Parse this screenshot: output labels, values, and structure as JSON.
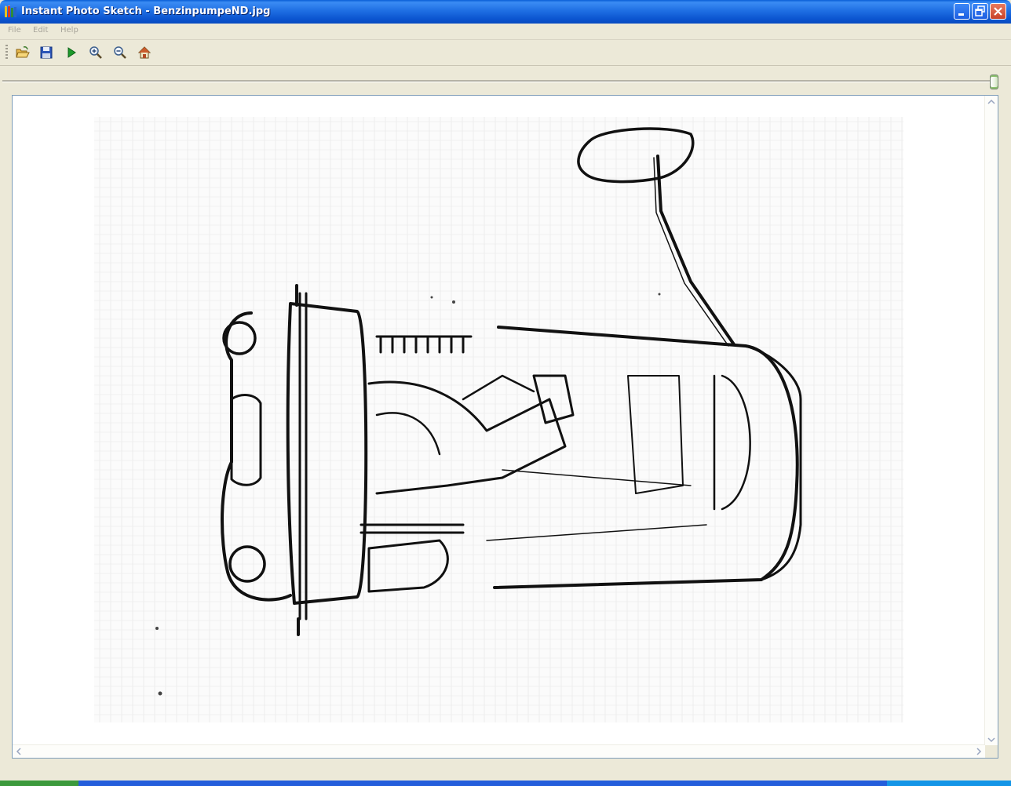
{
  "window": {
    "title": "Instant Photo Sketch - BenzinpumpeND.jpg",
    "controls": [
      "minimize",
      "maximize",
      "close"
    ]
  },
  "menu": {
    "items": [
      {
        "label": "File"
      },
      {
        "label": "Edit"
      },
      {
        "label": "Help"
      }
    ]
  },
  "toolbar": {
    "buttons": [
      {
        "name": "open",
        "icon": "folder-open-icon"
      },
      {
        "name": "save",
        "icon": "floppy-disk-icon"
      },
      {
        "name": "run",
        "icon": "play-icon"
      },
      {
        "name": "zoom-in",
        "icon": "zoom-in-icon"
      },
      {
        "name": "zoom-out",
        "icon": "zoom-out-icon"
      },
      {
        "name": "home",
        "icon": "home-icon"
      }
    ]
  },
  "slider": {
    "value_fraction": 1.0
  },
  "canvas": {
    "image_description_icon": "pencil-sketch-fuel-pump",
    "colors": {
      "paper": "#fbfbfb",
      "ink": "#111111"
    }
  },
  "colors": {
    "titlebar": "#0a55d0",
    "chrome": "#ece9d8",
    "close_button": "#d4563c"
  }
}
